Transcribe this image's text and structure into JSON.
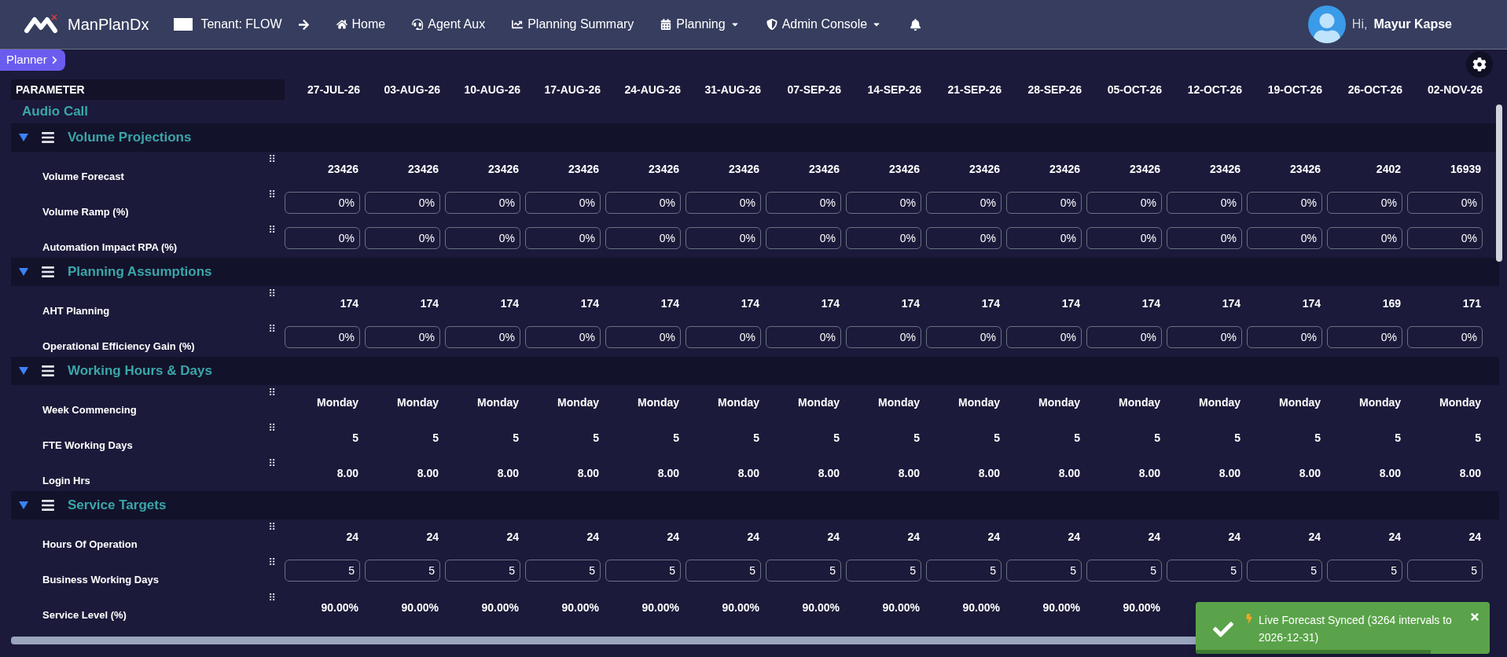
{
  "nav": {
    "brand": "ManPlanDx",
    "tenant": "Tenant: FLOW",
    "items": [
      {
        "label": "Home",
        "dropdown": false
      },
      {
        "label": "Agent Aux",
        "dropdown": false
      },
      {
        "label": "Planning Summary",
        "dropdown": false
      },
      {
        "label": "Planning",
        "dropdown": true
      },
      {
        "label": "Admin Console",
        "dropdown": true
      }
    ],
    "greeting": "Hi,",
    "user": "Mayur Kapse"
  },
  "planner_tab": "Planner",
  "table": {
    "parameter_heading": "PARAMETER",
    "dates": [
      "27-JUL-26",
      "03-AUG-26",
      "10-AUG-26",
      "17-AUG-26",
      "24-AUG-26",
      "31-AUG-26",
      "07-SEP-26",
      "14-SEP-26",
      "21-SEP-26",
      "28-SEP-26",
      "05-OCT-26",
      "12-OCT-26",
      "19-OCT-26",
      "26-OCT-26",
      "02-NOV-26"
    ],
    "group": "Audio Call",
    "sections": [
      {
        "title": "Volume Projections",
        "expanded": true,
        "rows": [
          {
            "label": "Volume Forecast",
            "kind": "value",
            "values": [
              "23426",
              "23426",
              "23426",
              "23426",
              "23426",
              "23426",
              "23426",
              "23426",
              "23426",
              "23426",
              "23426",
              "23426",
              "23426",
              "2402",
              "16939"
            ]
          },
          {
            "label": "Volume Ramp (%)",
            "kind": "input",
            "values": [
              "0%",
              "0%",
              "0%",
              "0%",
              "0%",
              "0%",
              "0%",
              "0%",
              "0%",
              "0%",
              "0%",
              "0%",
              "0%",
              "0%",
              "0%"
            ]
          },
          {
            "label": "Automation Impact RPA (%)",
            "kind": "input",
            "values": [
              "0%",
              "0%",
              "0%",
              "0%",
              "0%",
              "0%",
              "0%",
              "0%",
              "0%",
              "0%",
              "0%",
              "0%",
              "0%",
              "0%",
              "0%"
            ]
          }
        ]
      },
      {
        "title": "Planning Assumptions",
        "expanded": true,
        "rows": [
          {
            "label": "AHT Planning",
            "kind": "value",
            "values": [
              "174",
              "174",
              "174",
              "174",
              "174",
              "174",
              "174",
              "174",
              "174",
              "174",
              "174",
              "174",
              "174",
              "169",
              "171"
            ]
          },
          {
            "label": "Operational Efficiency Gain (%)",
            "kind": "input",
            "values": [
              "0%",
              "0%",
              "0%",
              "0%",
              "0%",
              "0%",
              "0%",
              "0%",
              "0%",
              "0%",
              "0%",
              "0%",
              "0%",
              "0%",
              "0%"
            ]
          }
        ]
      },
      {
        "title": "Working Hours & Days",
        "expanded": true,
        "rows": [
          {
            "label": "Week Commencing",
            "kind": "value",
            "values": [
              "Monday",
              "Monday",
              "Monday",
              "Monday",
              "Monday",
              "Monday",
              "Monday",
              "Monday",
              "Monday",
              "Monday",
              "Monday",
              "Monday",
              "Monday",
              "Monday",
              "Monday"
            ]
          },
          {
            "label": "FTE Working Days",
            "kind": "value",
            "values": [
              "5",
              "5",
              "5",
              "5",
              "5",
              "5",
              "5",
              "5",
              "5",
              "5",
              "5",
              "5",
              "5",
              "5",
              "5"
            ]
          },
          {
            "label": "Login Hrs",
            "kind": "value",
            "values": [
              "8.00",
              "8.00",
              "8.00",
              "8.00",
              "8.00",
              "8.00",
              "8.00",
              "8.00",
              "8.00",
              "8.00",
              "8.00",
              "8.00",
              "8.00",
              "8.00",
              "8.00"
            ]
          }
        ]
      },
      {
        "title": "Service Targets",
        "expanded": true,
        "rows": [
          {
            "label": "Hours Of Operation",
            "kind": "value",
            "values": [
              "24",
              "24",
              "24",
              "24",
              "24",
              "24",
              "24",
              "24",
              "24",
              "24",
              "24",
              "24",
              "24",
              "24",
              "24"
            ]
          },
          {
            "label": "Business Working Days",
            "kind": "input",
            "values": [
              "5",
              "5",
              "5",
              "5",
              "5",
              "5",
              "5",
              "5",
              "5",
              "5",
              "5",
              "5",
              "5",
              "5",
              "5"
            ]
          },
          {
            "label": "Service Level (%)",
            "kind": "value",
            "values": [
              "90.00%",
              "90.00%",
              "90.00%",
              "90.00%",
              "90.00%",
              "90.00%",
              "90.00%",
              "90.00%",
              "90.00%",
              "90.00%",
              "90.00%"
            ]
          }
        ]
      }
    ]
  },
  "toast": {
    "message": "Live Forecast Synced (3264 intervals to 2026-12-31)",
    "level": 0.8
  }
}
